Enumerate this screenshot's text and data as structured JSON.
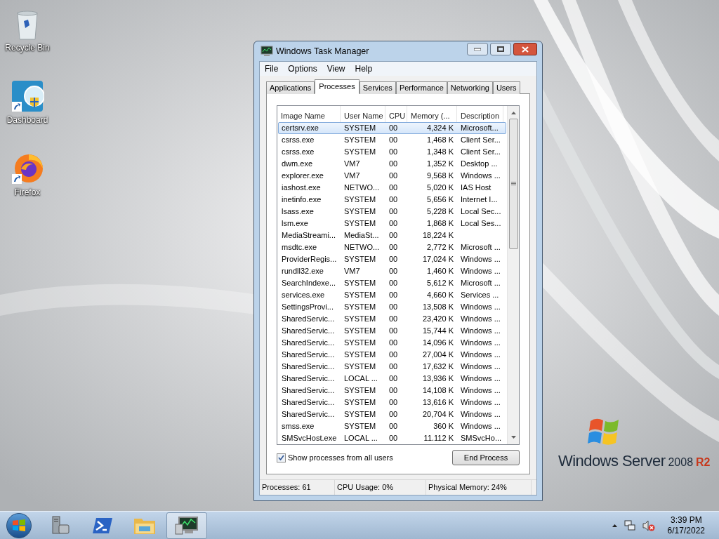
{
  "desktop_icons": [
    {
      "label": "Recycle Bin",
      "kind": "bin"
    },
    {
      "label": "Dashboard",
      "kind": "dashboard"
    },
    {
      "label": "Firefox",
      "kind": "firefox"
    }
  ],
  "window": {
    "title": "Windows Task Manager"
  },
  "menu": [
    "File",
    "Options",
    "View",
    "Help"
  ],
  "tabs": [
    {
      "label": "Applications",
      "selected": false
    },
    {
      "label": "Processes",
      "selected": true
    },
    {
      "label": "Services",
      "selected": false
    },
    {
      "label": "Performance",
      "selected": false
    },
    {
      "label": "Networking",
      "selected": false
    },
    {
      "label": "Users",
      "selected": false
    }
  ],
  "table": {
    "columns": [
      "Image Name",
      "User Name",
      "CPU",
      "Memory (...",
      "Description"
    ],
    "rows": [
      {
        "cells": [
          "certsrv.exe",
          "SYSTEM",
          "00",
          "4,324 K",
          "Microsoft..."
        ],
        "selected": true
      },
      {
        "cells": [
          "csrss.exe",
          "SYSTEM",
          "00",
          "1,468 K",
          "Client Ser..."
        ],
        "selected": false
      },
      {
        "cells": [
          "csrss.exe",
          "SYSTEM",
          "00",
          "1,348 K",
          "Client Ser..."
        ],
        "selected": false
      },
      {
        "cells": [
          "dwm.exe",
          "VM7",
          "00",
          "1,352 K",
          "Desktop ..."
        ],
        "selected": false
      },
      {
        "cells": [
          "explorer.exe",
          "VM7",
          "00",
          "9,568 K",
          "Windows ..."
        ],
        "selected": false
      },
      {
        "cells": [
          "iashost.exe",
          "NETWO...",
          "00",
          "5,020 K",
          "IAS Host"
        ],
        "selected": false
      },
      {
        "cells": [
          "inetinfo.exe",
          "SYSTEM",
          "00",
          "5,656 K",
          "Internet I..."
        ],
        "selected": false
      },
      {
        "cells": [
          "lsass.exe",
          "SYSTEM",
          "00",
          "5,228 K",
          "Local Sec..."
        ],
        "selected": false
      },
      {
        "cells": [
          "lsm.exe",
          "SYSTEM",
          "00",
          "1,868 K",
          "Local Ses..."
        ],
        "selected": false
      },
      {
        "cells": [
          "MediaStreami...",
          "MediaSt...",
          "00",
          "18,224 K",
          ""
        ],
        "selected": false
      },
      {
        "cells": [
          "msdtc.exe",
          "NETWO...",
          "00",
          "2,772 K",
          "Microsoft ..."
        ],
        "selected": false
      },
      {
        "cells": [
          "ProviderRegis...",
          "SYSTEM",
          "00",
          "17,024 K",
          "Windows ..."
        ],
        "selected": false
      },
      {
        "cells": [
          "rundll32.exe",
          "VM7",
          "00",
          "1,460 K",
          "Windows ..."
        ],
        "selected": false
      },
      {
        "cells": [
          "SearchIndexe...",
          "SYSTEM",
          "00",
          "5,612 K",
          "Microsoft ..."
        ],
        "selected": false
      },
      {
        "cells": [
          "services.exe",
          "SYSTEM",
          "00",
          "4,660 K",
          "Services ..."
        ],
        "selected": false
      },
      {
        "cells": [
          "SettingsProvi...",
          "SYSTEM",
          "00",
          "13,508 K",
          "Windows ..."
        ],
        "selected": false
      },
      {
        "cells": [
          "SharedServic...",
          "SYSTEM",
          "00",
          "23,420 K",
          "Windows ..."
        ],
        "selected": false
      },
      {
        "cells": [
          "SharedServic...",
          "SYSTEM",
          "00",
          "15,744 K",
          "Windows ..."
        ],
        "selected": false
      },
      {
        "cells": [
          "SharedServic...",
          "SYSTEM",
          "00",
          "14,096 K",
          "Windows ..."
        ],
        "selected": false
      },
      {
        "cells": [
          "SharedServic...",
          "SYSTEM",
          "00",
          "27,004 K",
          "Windows ..."
        ],
        "selected": false
      },
      {
        "cells": [
          "SharedServic...",
          "SYSTEM",
          "00",
          "17,632 K",
          "Windows ..."
        ],
        "selected": false
      },
      {
        "cells": [
          "SharedServic...",
          "LOCAL ...",
          "00",
          "13,936 K",
          "Windows ..."
        ],
        "selected": false
      },
      {
        "cells": [
          "SharedServic...",
          "SYSTEM",
          "00",
          "14,108 K",
          "Windows ..."
        ],
        "selected": false
      },
      {
        "cells": [
          "SharedServic...",
          "SYSTEM",
          "00",
          "13,616 K",
          "Windows ..."
        ],
        "selected": false
      },
      {
        "cells": [
          "SharedServic...",
          "SYSTEM",
          "00",
          "20,704 K",
          "Windows ..."
        ],
        "selected": false
      },
      {
        "cells": [
          "smss.exe",
          "SYSTEM",
          "00",
          "360 K",
          "Windows ..."
        ],
        "selected": false
      },
      {
        "cells": [
          "SMSvcHost.exe",
          "LOCAL ...",
          "00",
          "11.112 K",
          "SMSvcHo..."
        ],
        "selected": false
      }
    ]
  },
  "show_all_users": {
    "label": "Show processes from all users",
    "checked": true
  },
  "end_button": "End Process",
  "status_bar": [
    "Processes: 61",
    "CPU Usage: 0%",
    "Physical Memory: 24%"
  ],
  "branding": {
    "name": "Windows Server",
    "version": "2008",
    "edition": "R2"
  },
  "taskbar": {
    "buttons": [
      {
        "kind": "server",
        "active": false
      },
      {
        "kind": "powershell",
        "active": false
      },
      {
        "kind": "folder",
        "active": false
      },
      {
        "kind": "monitor",
        "active": true
      }
    ]
  },
  "clock": {
    "time": "3:39 PM",
    "date": "6/17/2022"
  }
}
